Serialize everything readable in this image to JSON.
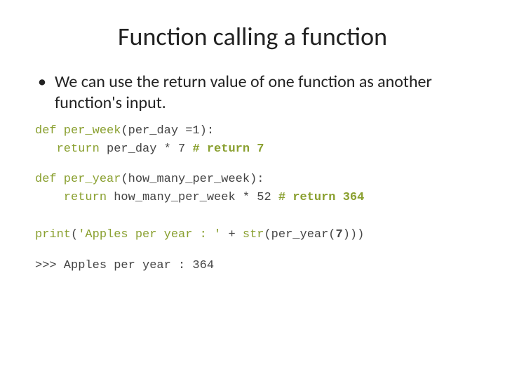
{
  "title": "Function calling a function",
  "bullet": "We can use the return value of one function as another function's input.",
  "code": {
    "l1_def": "def",
    "l1_fn": " per_week",
    "l1_rest": "(per_day =1):",
    "l2_indent": "   ",
    "l2_ret": "return",
    "l2_rest": " per_day * 7 ",
    "l2_cm": "# return 7",
    "l3_def": "def",
    "l3_fn": " per_year",
    "l3_rest": "(how_many_per_week):",
    "l4_indent": "    ",
    "l4_ret": "return",
    "l4_rest": " how_many_per_week * 52 ",
    "l4_cm": "# return 364",
    "l5_print": "print",
    "l5_paren1": "(",
    "l5_str": "'Apples per year : '",
    "l5_plus": " + ",
    "l5_strfn": "str",
    "l5_paren2": "(per_year(",
    "l5_seven": "7",
    "l5_close": ")))",
    "l6": ">>> Apples per year : 364"
  }
}
